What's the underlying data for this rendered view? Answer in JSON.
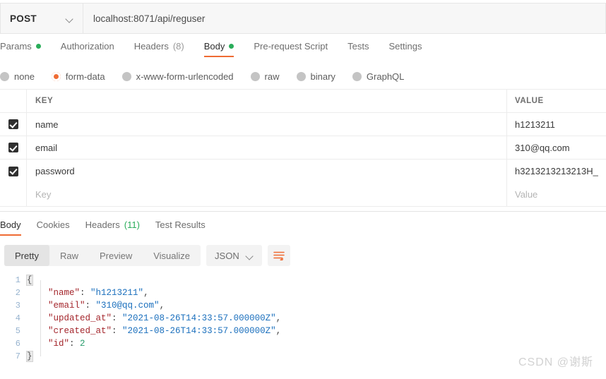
{
  "request": {
    "method": "POST",
    "url": "localhost:8071/api/reguser",
    "tabs": [
      {
        "label": "Params",
        "dot": true,
        "count": "",
        "active": false
      },
      {
        "label": "Authorization",
        "dot": false,
        "count": "",
        "active": false
      },
      {
        "label": "Headers",
        "dot": false,
        "count": "(8)",
        "active": false
      },
      {
        "label": "Body",
        "dot": true,
        "count": "",
        "active": true
      },
      {
        "label": "Pre-request Script",
        "dot": false,
        "count": "",
        "active": false
      },
      {
        "label": "Tests",
        "dot": false,
        "count": "",
        "active": false
      },
      {
        "label": "Settings",
        "dot": false,
        "count": "",
        "active": false
      }
    ],
    "body_types": [
      {
        "label": "none",
        "selected": false
      },
      {
        "label": "form-data",
        "selected": true
      },
      {
        "label": "x-www-form-urlencoded",
        "selected": false
      },
      {
        "label": "raw",
        "selected": false
      },
      {
        "label": "binary",
        "selected": false
      },
      {
        "label": "GraphQL",
        "selected": false
      }
    ],
    "table": {
      "headers": {
        "key": "KEY",
        "value": "VALUE"
      },
      "rows": [
        {
          "checked": true,
          "key": "name",
          "value": "h1213211"
        },
        {
          "checked": true,
          "key": "email",
          "value": "310@qq.com"
        },
        {
          "checked": true,
          "key": "password",
          "value": "h3213213213213H_"
        }
      ],
      "new_row": {
        "key_placeholder": "Key",
        "value_placeholder": "Value"
      }
    }
  },
  "response": {
    "tabs": [
      {
        "label": "Body",
        "count": "",
        "active": true
      },
      {
        "label": "Cookies",
        "count": "",
        "active": false
      },
      {
        "label": "Headers",
        "count": "(11)",
        "active": false
      },
      {
        "label": "Test Results",
        "count": "",
        "active": false
      }
    ],
    "view_modes": [
      {
        "label": "Pretty",
        "active": true
      },
      {
        "label": "Raw",
        "active": false
      },
      {
        "label": "Preview",
        "active": false
      },
      {
        "label": "Visualize",
        "active": false
      }
    ],
    "format": "JSON",
    "code_lines": [
      {
        "n": "1",
        "segs": [
          {
            "t": "{",
            "c": "brace"
          }
        ]
      },
      {
        "n": "2",
        "segs": [
          {
            "t": "    ",
            "c": "p"
          },
          {
            "t": "\"name\"",
            "c": "k"
          },
          {
            "t": ": ",
            "c": "p"
          },
          {
            "t": "\"h1213211\"",
            "c": "s"
          },
          {
            "t": ",",
            "c": "p"
          }
        ]
      },
      {
        "n": "3",
        "segs": [
          {
            "t": "    ",
            "c": "p"
          },
          {
            "t": "\"email\"",
            "c": "k"
          },
          {
            "t": ": ",
            "c": "p"
          },
          {
            "t": "\"310@qq.com\"",
            "c": "s"
          },
          {
            "t": ",",
            "c": "p"
          }
        ]
      },
      {
        "n": "4",
        "segs": [
          {
            "t": "    ",
            "c": "p"
          },
          {
            "t": "\"updated_at\"",
            "c": "k"
          },
          {
            "t": ": ",
            "c": "p"
          },
          {
            "t": "\"2021-08-26T14:33:57.000000Z\"",
            "c": "s"
          },
          {
            "t": ",",
            "c": "p"
          }
        ]
      },
      {
        "n": "5",
        "segs": [
          {
            "t": "    ",
            "c": "p"
          },
          {
            "t": "\"created_at\"",
            "c": "k"
          },
          {
            "t": ": ",
            "c": "p"
          },
          {
            "t": "\"2021-08-26T14:33:57.000000Z\"",
            "c": "s"
          },
          {
            "t": ",",
            "c": "p"
          }
        ]
      },
      {
        "n": "6",
        "segs": [
          {
            "t": "    ",
            "c": "p"
          },
          {
            "t": "\"id\"",
            "c": "k"
          },
          {
            "t": ": ",
            "c": "p"
          },
          {
            "t": "2",
            "c": "n"
          }
        ]
      },
      {
        "n": "7",
        "segs": [
          {
            "t": "}",
            "c": "brace"
          }
        ]
      }
    ]
  },
  "watermark": "CSDN @谢斯",
  "colors": {
    "accent": "#ef6b33",
    "green": "#2aad5a",
    "json_key": "#a4262c",
    "json_string": "#1a6fbd",
    "json_number": "#2a9d6e"
  }
}
